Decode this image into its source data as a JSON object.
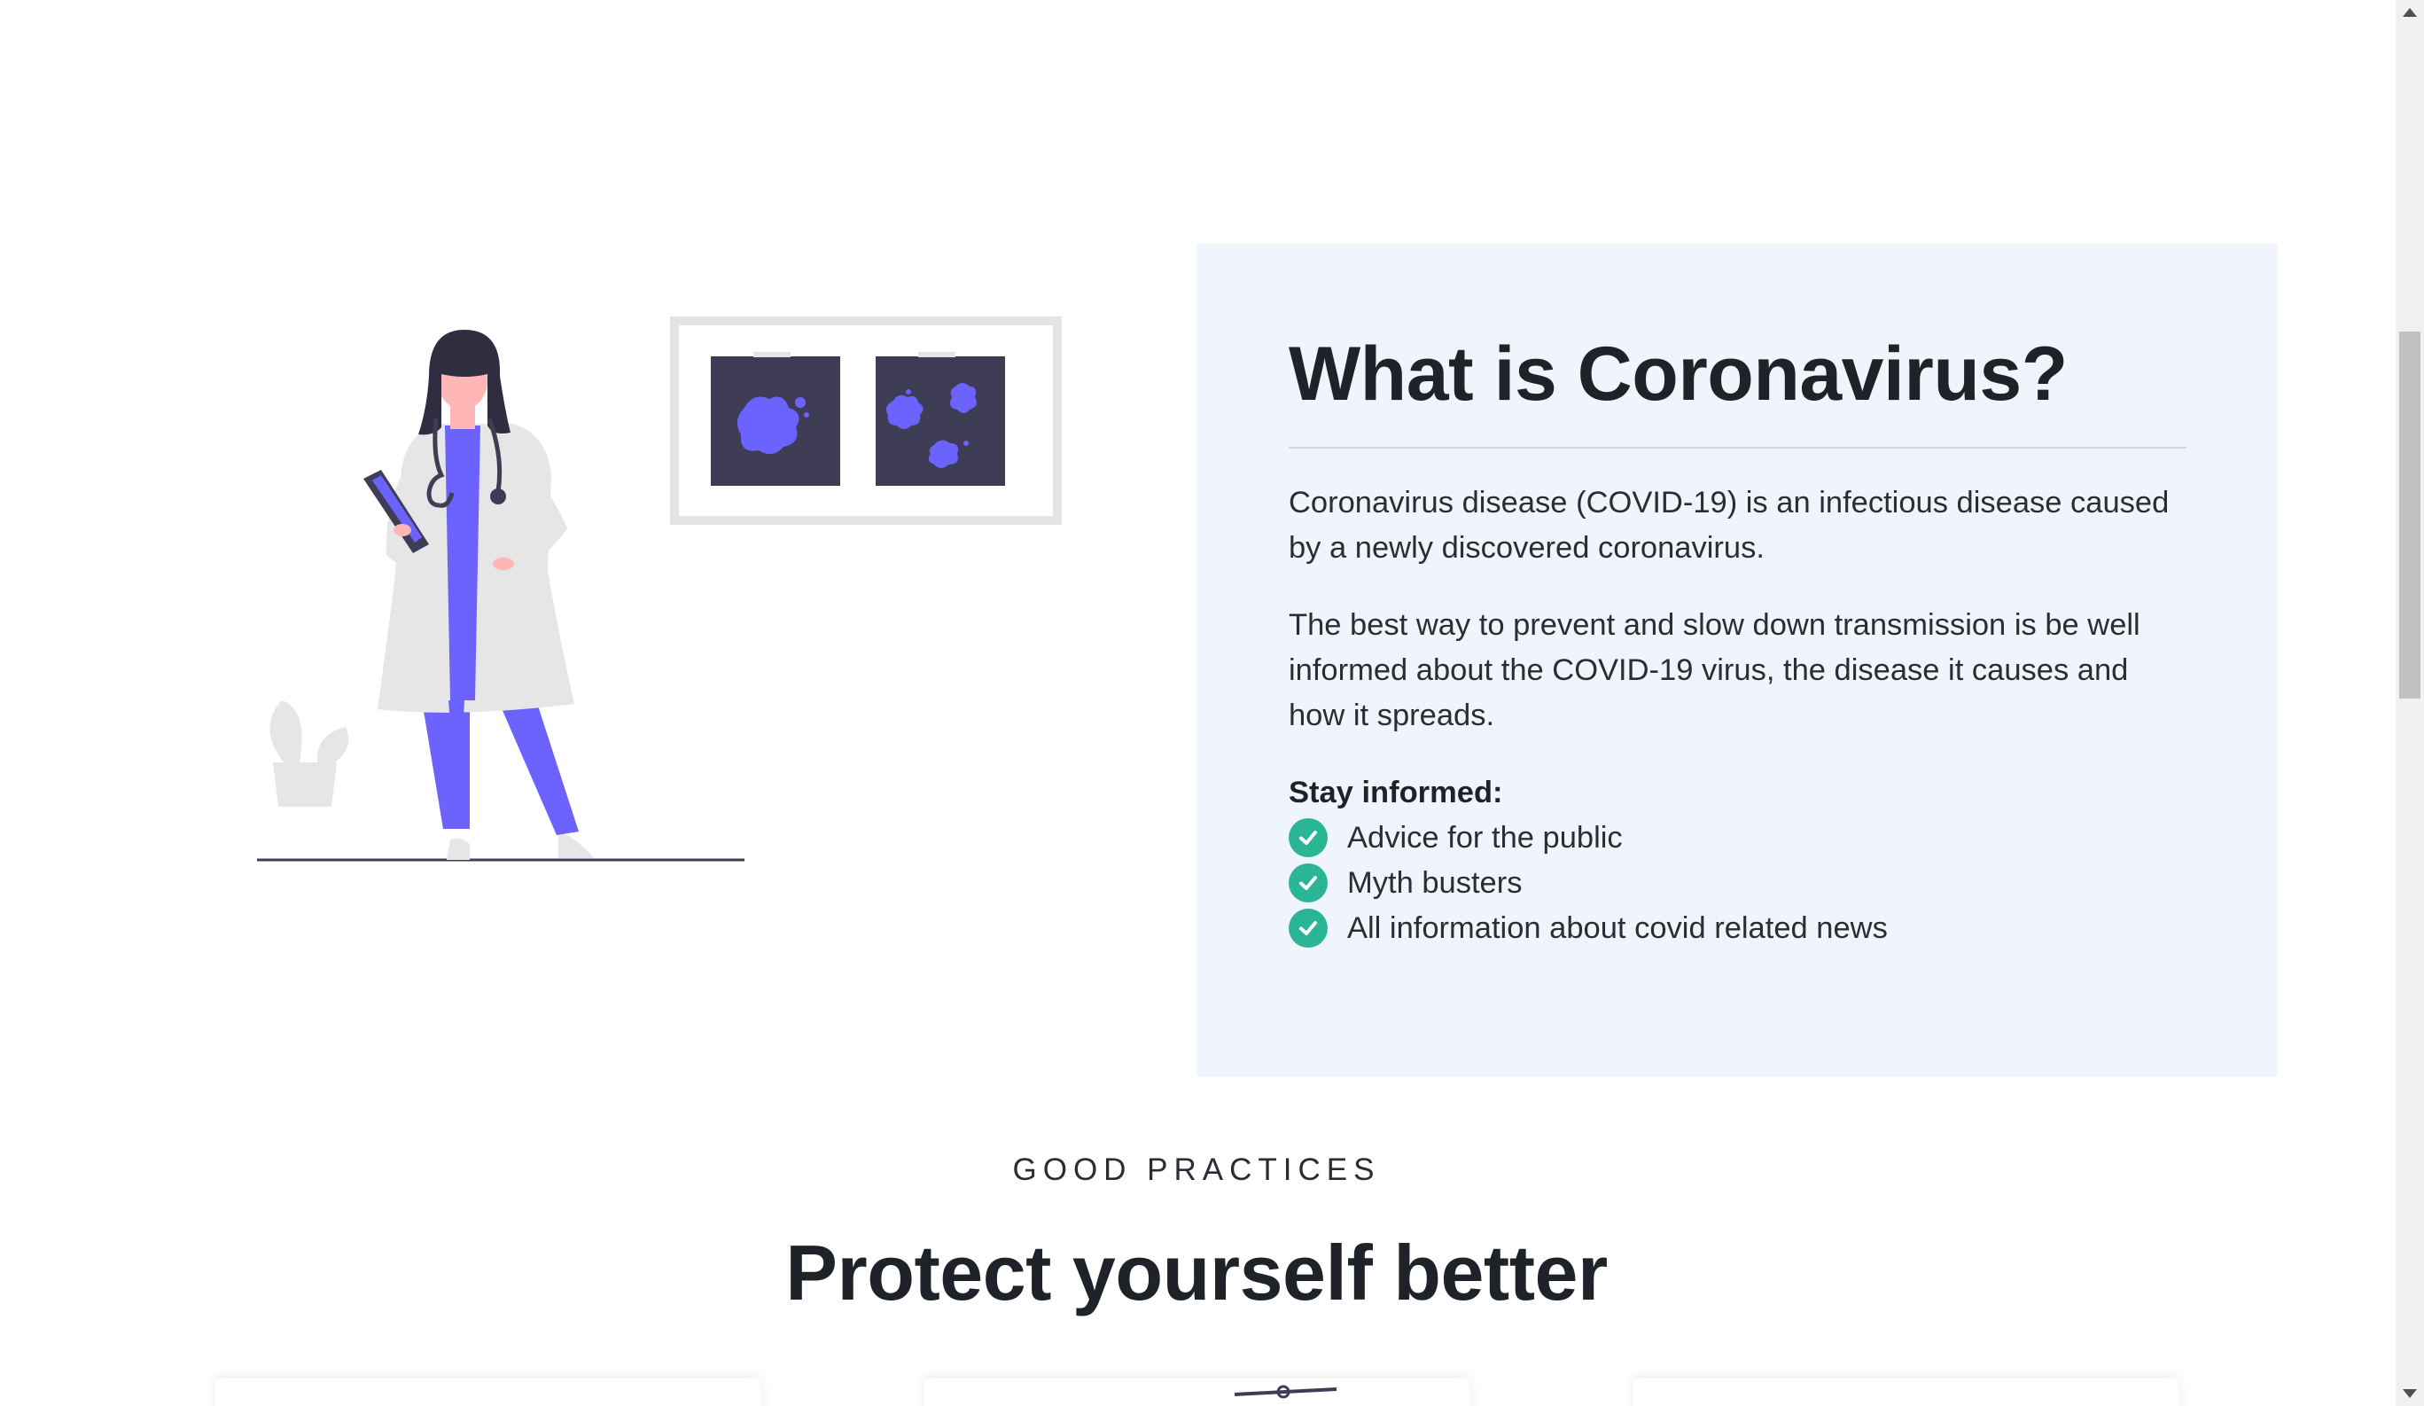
{
  "about": {
    "title": "What is Coronavirus?",
    "paragraph_1": "Coronavirus disease (COVID-19) is an infectious disease caused by a newly discovered coronavirus.",
    "paragraph_2": "The best way to prevent and slow down transmission is be well informed about the COVID-19 virus, the disease it causes and how it spreads.",
    "stay_informed_label": "Stay informed:",
    "links": [
      {
        "label": "Advice for the public",
        "icon": "check-circle-icon"
      },
      {
        "label": "Myth busters",
        "icon": "check-circle-icon"
      },
      {
        "label": "All information about covid related news",
        "icon": "check-circle-icon"
      }
    ],
    "card_background": "#f0f5fd",
    "check_color": "#2bb597"
  },
  "illustration": {
    "icon": "doctor-with-xrays-illustration",
    "accent_color": "#6c63ff",
    "dark_color": "#3f3d56"
  },
  "practices": {
    "eyebrow": "GOOD PRACTICES",
    "title": "Protect yourself better"
  },
  "colors": {
    "text": "#1f2329",
    "background": "#ffffff"
  }
}
